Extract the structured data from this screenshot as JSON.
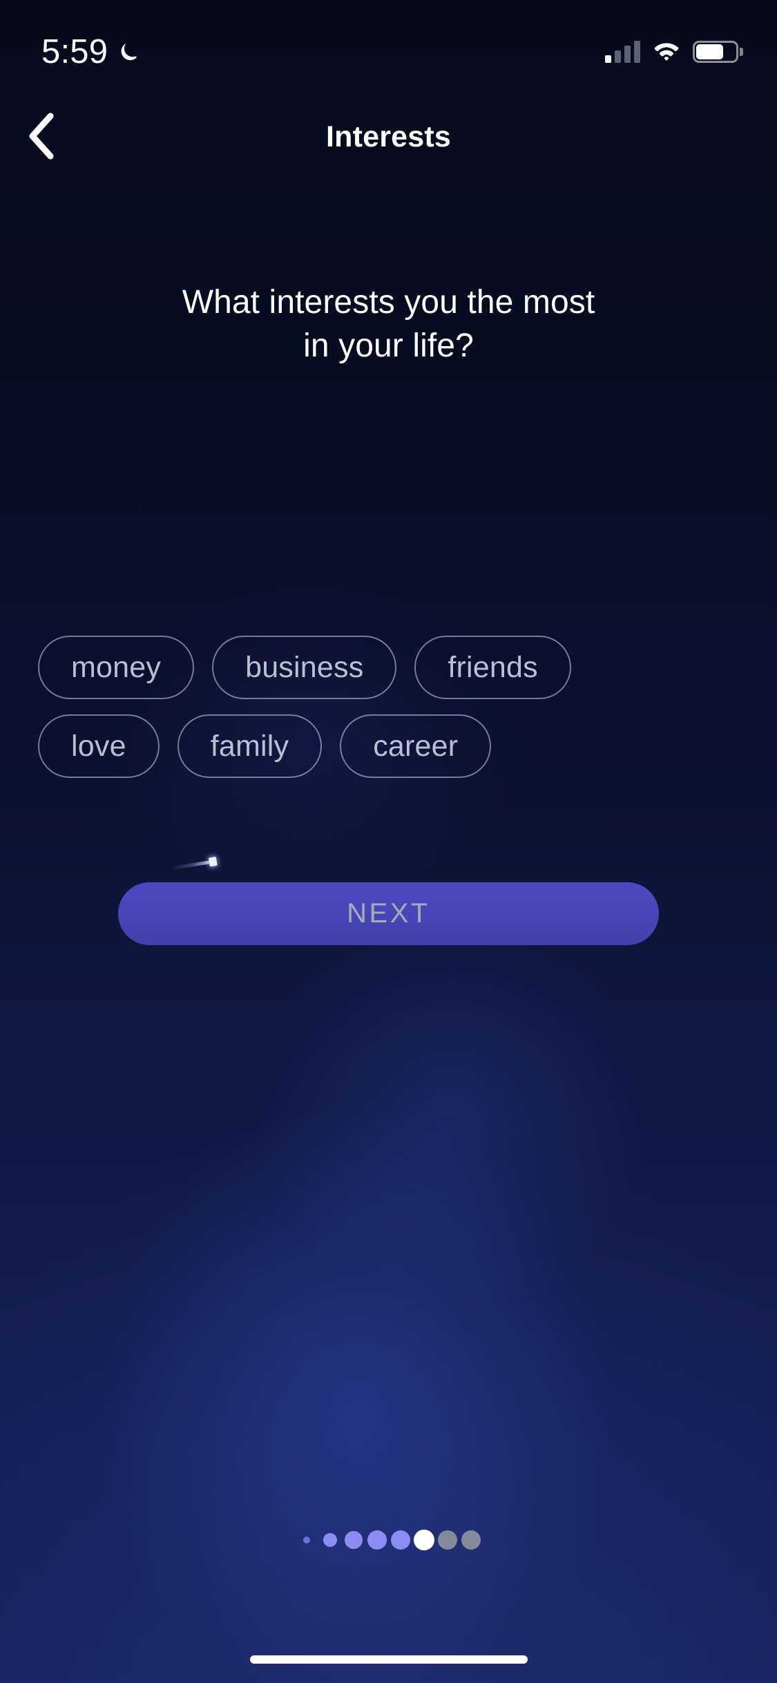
{
  "status_bar": {
    "time": "5:59",
    "dnd_icon": "crescent-moon-icon",
    "signal_icon": "cellular-signal-icon",
    "signal_bars_filled": 1,
    "wifi_icon": "wifi-icon",
    "battery_icon": "battery-icon",
    "battery_level_pct": 70
  },
  "navbar": {
    "back_icon": "chevron-left-icon",
    "title": "Interests"
  },
  "question": {
    "line1": "What interests you the most",
    "line2": "in your life?"
  },
  "chips": {
    "rows": [
      [
        {
          "label": "money",
          "selected": false
        },
        {
          "label": "business",
          "selected": false
        },
        {
          "label": "friends",
          "selected": false
        }
      ],
      [
        {
          "label": "love",
          "selected": false
        },
        {
          "label": "family",
          "selected": false
        },
        {
          "label": "career",
          "selected": false
        }
      ]
    ]
  },
  "decoration": {
    "shooting_star_icon": "shooting-star-icon"
  },
  "next_button": {
    "label": "NEXT",
    "enabled": false
  },
  "page_dots": {
    "total": 8,
    "active_index": 5,
    "dots": [
      {
        "size": 10,
        "color": "#6d6de0"
      },
      {
        "size": 20,
        "color": "#8c8cf2"
      },
      {
        "size": 26,
        "color": "#8c8cf2"
      },
      {
        "size": 28,
        "color": "#8c8cf2"
      },
      {
        "size": 28,
        "color": "#8c8cf2"
      },
      {
        "size": 30,
        "color": "#ffffff"
      },
      {
        "size": 28,
        "color": "#838a99"
      },
      {
        "size": 28,
        "color": "#838a99"
      }
    ]
  },
  "home_indicator": {
    "present": true
  },
  "colors": {
    "background_top": "#060b1c",
    "background_bottom": "#18245f",
    "accent": "#4746b8",
    "chip_border": "#c5ccde",
    "chip_text": "#b9c0d2",
    "next_text": "#a6abb8",
    "active_dot": "#ffffff"
  }
}
